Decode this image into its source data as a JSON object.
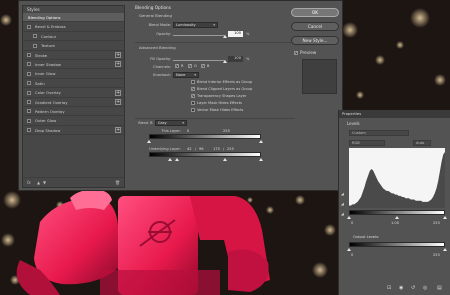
{
  "layer_style": {
    "styles_header": "Styles",
    "styles": [
      {
        "label": "Blending Options",
        "active": true,
        "checkbox": false,
        "indent": false,
        "plus": false
      },
      {
        "label": "Bevel & Emboss",
        "checkbox": true,
        "indent": false,
        "plus": false
      },
      {
        "label": "Contour",
        "checkbox": true,
        "indent": true,
        "plus": false
      },
      {
        "label": "Texture",
        "checkbox": true,
        "indent": true,
        "plus": false
      },
      {
        "label": "Stroke",
        "checkbox": true,
        "indent": false,
        "plus": true
      },
      {
        "label": "Inner Shadow",
        "checkbox": true,
        "indent": false,
        "plus": true
      },
      {
        "label": "Inner Glow",
        "checkbox": true,
        "indent": false,
        "plus": false
      },
      {
        "label": "Satin",
        "checkbox": true,
        "indent": false,
        "plus": false
      },
      {
        "label": "Color Overlay",
        "checkbox": true,
        "indent": false,
        "plus": true
      },
      {
        "label": "Gradient Overlay",
        "checkbox": true,
        "indent": false,
        "plus": true
      },
      {
        "label": "Pattern Overlay",
        "checkbox": true,
        "indent": false,
        "plus": false
      },
      {
        "label": "Outer Glow",
        "checkbox": true,
        "indent": false,
        "plus": false
      },
      {
        "label": "Drop Shadow",
        "checkbox": true,
        "indent": false,
        "plus": true
      }
    ],
    "footer": {
      "fx": "fx",
      "up": "▲",
      "down": "▼",
      "trash": "🗑"
    },
    "blending_options": {
      "title": "Blending Options",
      "general_title": "General Blending",
      "blend_mode_label": "Blend Mode:",
      "blend_mode_value": "Luminosity",
      "opacity_label": "Opacity:",
      "opacity_value": "100",
      "opacity_unit": "%",
      "advanced_title": "Advanced Blending",
      "fill_opacity_label": "Fill Opacity:",
      "fill_opacity_value": "100",
      "fill_opacity_unit": "%",
      "channels_label": "Channels:",
      "channel_r": "R",
      "channel_g": "G",
      "channel_b": "B",
      "knockout_label": "Knockout:",
      "knockout_value": "None",
      "options": [
        {
          "label": "Blend Interior Effects as Group",
          "checked": false
        },
        {
          "label": "Blend Clipped Layers as Group",
          "checked": true
        },
        {
          "label": "Transparency Shapes Layer",
          "checked": true
        },
        {
          "label": "Layer Mask Hides Effects",
          "checked": false
        },
        {
          "label": "Vector Mask Hides Effects",
          "checked": false
        }
      ],
      "blend_if_label": "Blend If:",
      "blend_if_value": "Gray",
      "this_layer_label": "This Layer:",
      "this_layer_low": "0",
      "this_layer_high": "255",
      "underlying_label": "Underlying Layer:",
      "underlying_v1": "42",
      "underlying_sep": "/",
      "underlying_v2": "96",
      "underlying_v3": "175",
      "underlying_sep2": "/",
      "underlying_v4": "255"
    },
    "buttons": {
      "ok": "OK",
      "cancel": "Cancel",
      "new_style": "New Style...",
      "preview": "Preview"
    }
  },
  "levels_panel": {
    "tab_label": "Properties",
    "title": "Levels",
    "preset_value": "Custom",
    "channel_value": "RGB",
    "auto_label": "Auto",
    "input_low": "0",
    "input_mid": "1.00",
    "input_high": "255",
    "output_label": "Output Levels:",
    "output_low": "0",
    "output_high": "255",
    "histogram": [
      2,
      2,
      3,
      3,
      4,
      5,
      7,
      9,
      13,
      17,
      22,
      26,
      30,
      32,
      31,
      28,
      25,
      22,
      20,
      18,
      16,
      15,
      14,
      14,
      13,
      12,
      12,
      11,
      11,
      10,
      10,
      9,
      9,
      8,
      8,
      8,
      7,
      7,
      7,
      6,
      6,
      6,
      6,
      5,
      5,
      5,
      5,
      6,
      7,
      9,
      12,
      16,
      22,
      30,
      38,
      44,
      46
    ]
  },
  "colors": {
    "accent": "#e6194f",
    "dialog": "#535353"
  }
}
